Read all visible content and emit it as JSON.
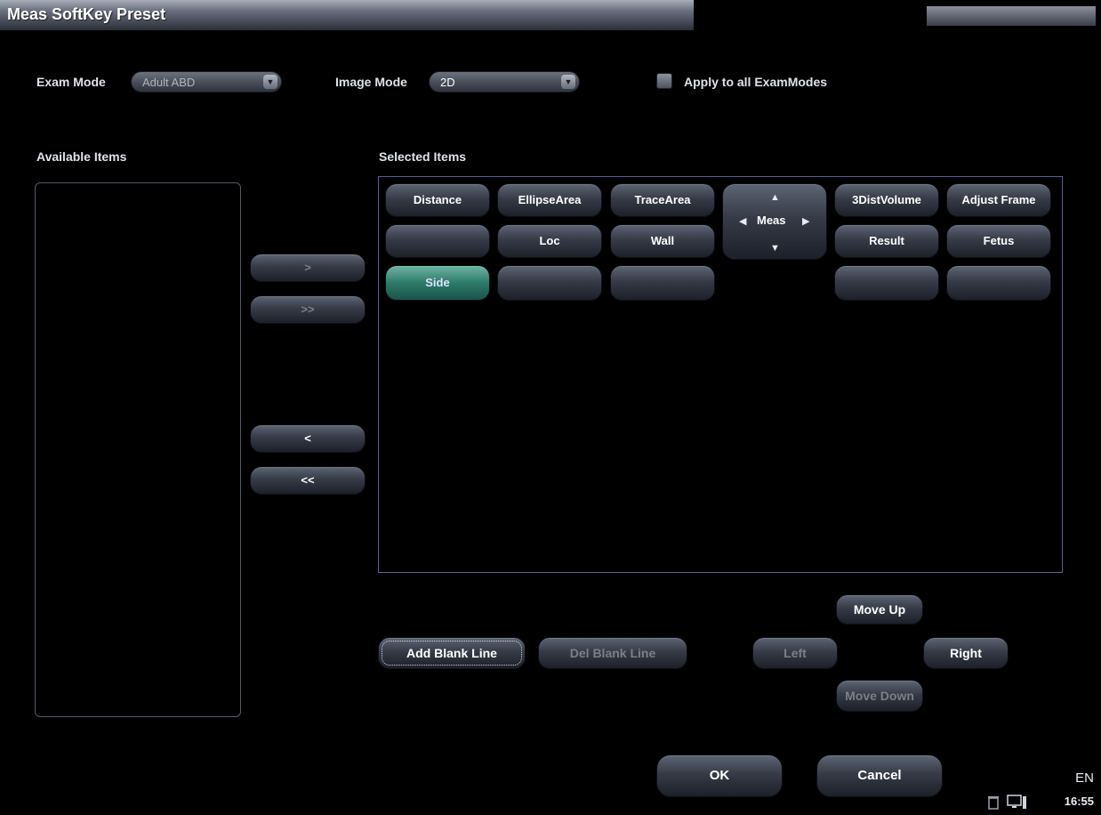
{
  "window": {
    "title": "Meas SoftKey Preset"
  },
  "exam_mode": {
    "label": "Exam Mode",
    "value": "Adult ABD"
  },
  "image_mode": {
    "label": "Image Mode",
    "value": "2D"
  },
  "apply_all": {
    "label": "Apply to all ExamModes",
    "checked": false
  },
  "available": {
    "label": "Available Items",
    "items": []
  },
  "selected": {
    "label": "Selected Items",
    "row1": [
      "Distance",
      "EllipseArea",
      "TraceArea",
      "3DistVolume",
      "Adjust Frame"
    ],
    "row2": [
      "",
      "Loc",
      "Wall",
      "Result",
      "Fetus"
    ],
    "row3": [
      "Side",
      "",
      "",
      "",
      ""
    ],
    "meas_label": "Meas"
  },
  "transfer": {
    "add_one": ">",
    "add_all": ">>",
    "remove_one": "<",
    "remove_all": "<<"
  },
  "actions": {
    "add_blank": "Add Blank Line",
    "del_blank": "Del Blank Line",
    "move_up": "Move Up",
    "left": "Left",
    "right": "Right",
    "move_down": "Move Down"
  },
  "footer": {
    "ok": "OK",
    "cancel": "Cancel"
  },
  "status": {
    "lang": "EN",
    "time": "16:55"
  }
}
